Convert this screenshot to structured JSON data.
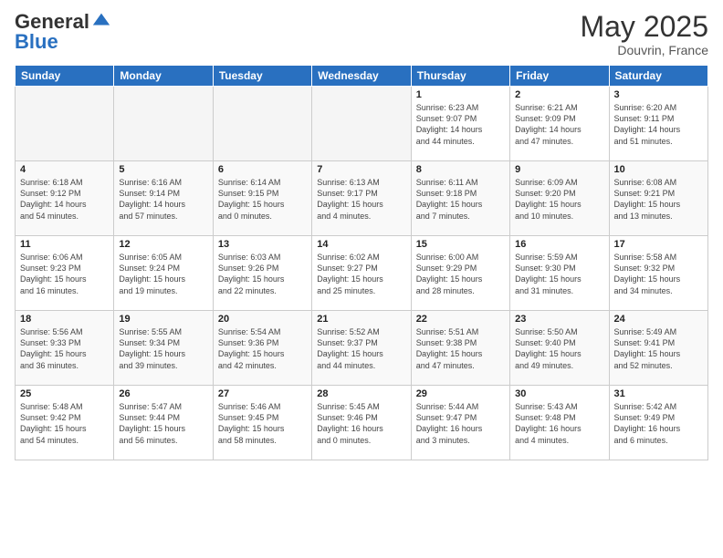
{
  "header": {
    "logo_general": "General",
    "logo_blue": "Blue",
    "month_year": "May 2025",
    "location": "Douvrin, France"
  },
  "weekdays": [
    "Sunday",
    "Monday",
    "Tuesday",
    "Wednesday",
    "Thursday",
    "Friday",
    "Saturday"
  ],
  "weeks": [
    [
      {
        "day": "",
        "info": ""
      },
      {
        "day": "",
        "info": ""
      },
      {
        "day": "",
        "info": ""
      },
      {
        "day": "",
        "info": ""
      },
      {
        "day": "1",
        "info": "Sunrise: 6:23 AM\nSunset: 9:07 PM\nDaylight: 14 hours\nand 44 minutes."
      },
      {
        "day": "2",
        "info": "Sunrise: 6:21 AM\nSunset: 9:09 PM\nDaylight: 14 hours\nand 47 minutes."
      },
      {
        "day": "3",
        "info": "Sunrise: 6:20 AM\nSunset: 9:11 PM\nDaylight: 14 hours\nand 51 minutes."
      }
    ],
    [
      {
        "day": "4",
        "info": "Sunrise: 6:18 AM\nSunset: 9:12 PM\nDaylight: 14 hours\nand 54 minutes."
      },
      {
        "day": "5",
        "info": "Sunrise: 6:16 AM\nSunset: 9:14 PM\nDaylight: 14 hours\nand 57 minutes."
      },
      {
        "day": "6",
        "info": "Sunrise: 6:14 AM\nSunset: 9:15 PM\nDaylight: 15 hours\nand 0 minutes."
      },
      {
        "day": "7",
        "info": "Sunrise: 6:13 AM\nSunset: 9:17 PM\nDaylight: 15 hours\nand 4 minutes."
      },
      {
        "day": "8",
        "info": "Sunrise: 6:11 AM\nSunset: 9:18 PM\nDaylight: 15 hours\nand 7 minutes."
      },
      {
        "day": "9",
        "info": "Sunrise: 6:09 AM\nSunset: 9:20 PM\nDaylight: 15 hours\nand 10 minutes."
      },
      {
        "day": "10",
        "info": "Sunrise: 6:08 AM\nSunset: 9:21 PM\nDaylight: 15 hours\nand 13 minutes."
      }
    ],
    [
      {
        "day": "11",
        "info": "Sunrise: 6:06 AM\nSunset: 9:23 PM\nDaylight: 15 hours\nand 16 minutes."
      },
      {
        "day": "12",
        "info": "Sunrise: 6:05 AM\nSunset: 9:24 PM\nDaylight: 15 hours\nand 19 minutes."
      },
      {
        "day": "13",
        "info": "Sunrise: 6:03 AM\nSunset: 9:26 PM\nDaylight: 15 hours\nand 22 minutes."
      },
      {
        "day": "14",
        "info": "Sunrise: 6:02 AM\nSunset: 9:27 PM\nDaylight: 15 hours\nand 25 minutes."
      },
      {
        "day": "15",
        "info": "Sunrise: 6:00 AM\nSunset: 9:29 PM\nDaylight: 15 hours\nand 28 minutes."
      },
      {
        "day": "16",
        "info": "Sunrise: 5:59 AM\nSunset: 9:30 PM\nDaylight: 15 hours\nand 31 minutes."
      },
      {
        "day": "17",
        "info": "Sunrise: 5:58 AM\nSunset: 9:32 PM\nDaylight: 15 hours\nand 34 minutes."
      }
    ],
    [
      {
        "day": "18",
        "info": "Sunrise: 5:56 AM\nSunset: 9:33 PM\nDaylight: 15 hours\nand 36 minutes."
      },
      {
        "day": "19",
        "info": "Sunrise: 5:55 AM\nSunset: 9:34 PM\nDaylight: 15 hours\nand 39 minutes."
      },
      {
        "day": "20",
        "info": "Sunrise: 5:54 AM\nSunset: 9:36 PM\nDaylight: 15 hours\nand 42 minutes."
      },
      {
        "day": "21",
        "info": "Sunrise: 5:52 AM\nSunset: 9:37 PM\nDaylight: 15 hours\nand 44 minutes."
      },
      {
        "day": "22",
        "info": "Sunrise: 5:51 AM\nSunset: 9:38 PM\nDaylight: 15 hours\nand 47 minutes."
      },
      {
        "day": "23",
        "info": "Sunrise: 5:50 AM\nSunset: 9:40 PM\nDaylight: 15 hours\nand 49 minutes."
      },
      {
        "day": "24",
        "info": "Sunrise: 5:49 AM\nSunset: 9:41 PM\nDaylight: 15 hours\nand 52 minutes."
      }
    ],
    [
      {
        "day": "25",
        "info": "Sunrise: 5:48 AM\nSunset: 9:42 PM\nDaylight: 15 hours\nand 54 minutes."
      },
      {
        "day": "26",
        "info": "Sunrise: 5:47 AM\nSunset: 9:44 PM\nDaylight: 15 hours\nand 56 minutes."
      },
      {
        "day": "27",
        "info": "Sunrise: 5:46 AM\nSunset: 9:45 PM\nDaylight: 15 hours\nand 58 minutes."
      },
      {
        "day": "28",
        "info": "Sunrise: 5:45 AM\nSunset: 9:46 PM\nDaylight: 16 hours\nand 0 minutes."
      },
      {
        "day": "29",
        "info": "Sunrise: 5:44 AM\nSunset: 9:47 PM\nDaylight: 16 hours\nand 3 minutes."
      },
      {
        "day": "30",
        "info": "Sunrise: 5:43 AM\nSunset: 9:48 PM\nDaylight: 16 hours\nand 4 minutes."
      },
      {
        "day": "31",
        "info": "Sunrise: 5:42 AM\nSunset: 9:49 PM\nDaylight: 16 hours\nand 6 minutes."
      }
    ]
  ]
}
